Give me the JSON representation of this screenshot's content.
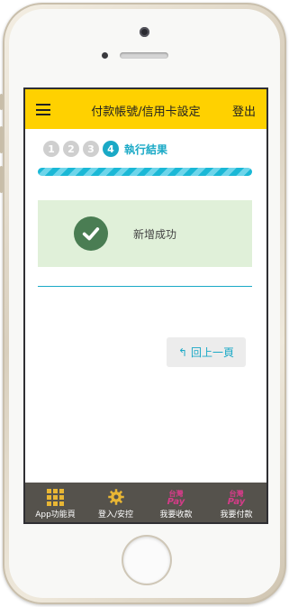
{
  "header": {
    "title": "付款帳號/信用卡設定",
    "logout_label": "登出"
  },
  "steps": {
    "items": [
      "1",
      "2",
      "3",
      "4"
    ],
    "current_label": "執行結果",
    "progress": 1.0
  },
  "result": {
    "message": "新增成功",
    "status_color": "#4a7d53"
  },
  "actions": {
    "back_label": "回上一頁"
  },
  "bottom_nav": [
    {
      "label": "App功能頁",
      "icon": "grid-icon"
    },
    {
      "label": "登入/安控",
      "icon": "gear-icon"
    },
    {
      "label": "我要收款",
      "icon": "taiwan-pay-icon",
      "icon_text": "台灣",
      "icon_text2": "Pay"
    },
    {
      "label": "我要付款",
      "icon": "taiwan-pay-icon",
      "icon_text": "台灣",
      "icon_text2": "Pay"
    }
  ],
  "colors": {
    "header_bg": "#ffd100",
    "accent": "#1aa9c6",
    "nav_bg": "#55524c"
  }
}
